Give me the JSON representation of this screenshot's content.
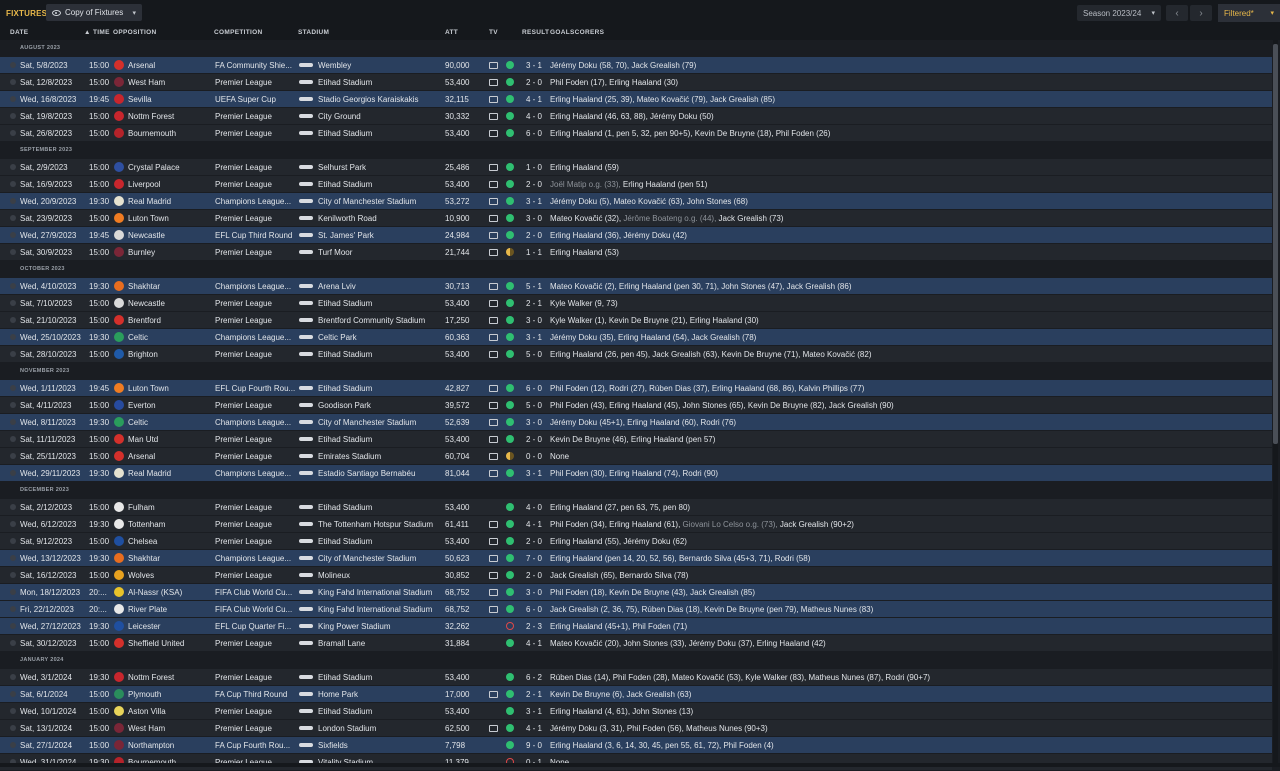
{
  "toolbar": {
    "title": "FIXTURES",
    "view_label": "Copy of Fixtures",
    "season_label": "Season 2023/24",
    "filter_label": "Filtered*"
  },
  "columns": {
    "date": "DATE",
    "time": "TIME",
    "opposition": "OPPOSITION",
    "competition": "COMPETITION",
    "stadium": "STADIUM",
    "att": "ATT",
    "tv": "TV",
    "result": "RESULT",
    "goalscorers": "GOALSCORERS"
  },
  "colors": {
    "accent": "#e8b84a",
    "highlight_row": "#2a3f5e",
    "win": "#2fbf71",
    "draw": "#e8b84a",
    "loss": "#e04848"
  },
  "months": [
    {
      "label": "AUGUST 2023",
      "rows": [
        {
          "date": "Sat, 5/8/2023",
          "time": "15:00",
          "opp": "Arsenal",
          "crest": "#d4302b",
          "comp": "FA Community Shie...",
          "stadium": "Wembley",
          "att": "90,000",
          "tv": true,
          "result": "w",
          "score": "3 - 1",
          "goals": "Jérémy Doku (58, 70), Jack Grealish (79)",
          "hl": true
        },
        {
          "date": "Sat, 12/8/2023",
          "time": "15:00",
          "opp": "West Ham",
          "crest": "#7a2637",
          "comp": "Premier League",
          "stadium": "Etihad Stadium",
          "att": "53,400",
          "tv": true,
          "result": "w",
          "score": "2 - 0",
          "goals": "Phil Foden (17), Erling Haaland (30)",
          "hl": false
        },
        {
          "date": "Wed, 16/8/2023",
          "time": "19:45",
          "opp": "Sevilla",
          "crest": "#c8262d",
          "comp": "UEFA Super Cup",
          "stadium": "Stadio Georgios Karaiskakis",
          "att": "32,115",
          "tv": true,
          "result": "w",
          "score": "4 - 1",
          "goals": "Erling Haaland (25, 39), Mateo Kovačić (79), Jack Grealish (85)",
          "hl": true
        },
        {
          "date": "Sat, 19/8/2023",
          "time": "15:00",
          "opp": "Nottm Forest",
          "crest": "#c8262d",
          "comp": "Premier League",
          "stadium": "City Ground",
          "att": "30,332",
          "tv": true,
          "result": "w",
          "score": "4 - 0",
          "goals": "Erling Haaland (46, 63, 88), Jérémy Doku (50)",
          "hl": false
        },
        {
          "date": "Sat, 26/8/2023",
          "time": "15:00",
          "opp": "Bournemouth",
          "crest": "#b5232a",
          "comp": "Premier League",
          "stadium": "Etihad Stadium",
          "att": "53,400",
          "tv": true,
          "result": "w",
          "score": "6 - 0",
          "goals": "Erling Haaland (1, pen 5, 32, pen 90+5), Kevin De Bruyne (18), Phil Foden (26)",
          "hl": false
        }
      ]
    },
    {
      "label": "SEPTEMBER 2023",
      "rows": [
        {
          "date": "Sat, 2/9/2023",
          "time": "15:00",
          "opp": "Crystal Palace",
          "crest": "#2e4fa0",
          "comp": "Premier League",
          "stadium": "Selhurst Park",
          "att": "25,486",
          "tv": true,
          "result": "w",
          "score": "1 - 0",
          "goals": "Erling Haaland (59)",
          "hl": false
        },
        {
          "date": "Sat, 16/9/2023",
          "time": "15:00",
          "opp": "Liverpool",
          "crest": "#c8262d",
          "comp": "Premier League",
          "stadium": "Etihad Stadium",
          "att": "53,400",
          "tv": true,
          "result": "w",
          "score": "2 - 0",
          "goals_muted": "Joël Matip o.g. (33), ",
          "goals": "Erling Haaland (pen 51)",
          "hl": false
        },
        {
          "date": "Wed, 20/9/2023",
          "time": "19:30",
          "opp": "Real Madrid",
          "crest": "#e5e2d0",
          "comp": "Champions League...",
          "stadium": "City of Manchester Stadium",
          "att": "53,272",
          "tv": true,
          "result": "w",
          "score": "3 - 1",
          "goals": "Jérémy Doku (5), Mateo Kovačić (63), John Stones (68)",
          "hl": true
        },
        {
          "date": "Sat, 23/9/2023",
          "time": "15:00",
          "opp": "Luton Town",
          "crest": "#f07c22",
          "comp": "Premier League",
          "stadium": "Kenilworth Road",
          "att": "10,900",
          "tv": true,
          "result": "w",
          "score": "3 - 0",
          "goals": "Mateo Kovačić (32), ",
          "goals_muted2": "Jérôme Boateng o.g. (44), ",
          "goals2": "Jack Grealish (73)",
          "hl": false
        },
        {
          "date": "Wed, 27/9/2023",
          "time": "19:45",
          "opp": "Newcastle",
          "crest": "#d9d9d9",
          "comp": "EFL Cup Third Round",
          "stadium": "St. James' Park",
          "att": "24,984",
          "tv": true,
          "result": "w",
          "score": "2 - 0",
          "goals": "Erling Haaland (36), Jérémy Doku (42)",
          "hl": true
        },
        {
          "date": "Sat, 30/9/2023",
          "time": "15:00",
          "opp": "Burnley",
          "crest": "#7a2637",
          "comp": "Premier League",
          "stadium": "Turf Moor",
          "att": "21,744",
          "tv": true,
          "result": "d",
          "score": "1 - 1",
          "goals": "Erling Haaland (53)",
          "hl": false
        }
      ]
    },
    {
      "label": "OCTOBER 2023",
      "rows": [
        {
          "date": "Wed, 4/10/2023",
          "time": "19:30",
          "opp": "Shakhtar",
          "crest": "#e86d1f",
          "comp": "Champions League...",
          "stadium": "Arena Lviv",
          "att": "30,713",
          "tv": true,
          "result": "w",
          "score": "5 - 1",
          "goals": "Mateo Kovačić (2), Erling Haaland (pen 30, 71), John Stones (47), Jack Grealish (86)",
          "hl": true
        },
        {
          "date": "Sat, 7/10/2023",
          "time": "15:00",
          "opp": "Newcastle",
          "crest": "#d9d9d9",
          "comp": "Premier League",
          "stadium": "Etihad Stadium",
          "att": "53,400",
          "tv": true,
          "result": "w",
          "score": "2 - 1",
          "goals": "Kyle Walker (9, 73)",
          "hl": false
        },
        {
          "date": "Sat, 21/10/2023",
          "time": "15:00",
          "opp": "Brentford",
          "crest": "#d4302b",
          "comp": "Premier League",
          "stadium": "Brentford Community Stadium",
          "att": "17,250",
          "tv": true,
          "result": "w",
          "score": "3 - 0",
          "goals": "Kyle Walker (1), Kevin De Bruyne (21), Erling Haaland (30)",
          "hl": false
        },
        {
          "date": "Wed, 25/10/2023",
          "time": "19:30",
          "opp": "Celtic",
          "crest": "#2a9d5c",
          "comp": "Champions League...",
          "stadium": "Celtic Park",
          "att": "60,363",
          "tv": true,
          "result": "w",
          "score": "3 - 1",
          "goals": "Jérémy Doku (35), Erling Haaland (54), Jack Grealish (78)",
          "hl": true
        },
        {
          "date": "Sat, 28/10/2023",
          "time": "15:00",
          "opp": "Brighton",
          "crest": "#1f5aa8",
          "comp": "Premier League",
          "stadium": "Etihad Stadium",
          "att": "53,400",
          "tv": true,
          "result": "w",
          "score": "5 - 0",
          "goals": "Erling Haaland (26, pen 45), Jack Grealish (63), Kevin De Bruyne (71), Mateo Kovačić (82)",
          "hl": false
        }
      ]
    },
    {
      "label": "NOVEMBER 2023",
      "rows": [
        {
          "date": "Wed, 1/11/2023",
          "time": "19:45",
          "opp": "Luton Town",
          "crest": "#f07c22",
          "comp": "EFL Cup Fourth Rou...",
          "stadium": "Etihad Stadium",
          "att": "42,827",
          "tv": true,
          "result": "w",
          "score": "6 - 0",
          "goals": "Phil Foden (12), Rodri (27), Rúben Dias (37), Erling Haaland (68, 86), Kalvin Phillips (77)",
          "hl": true
        },
        {
          "date": "Sat, 4/11/2023",
          "time": "15:00",
          "opp": "Everton",
          "crest": "#274b9f",
          "comp": "Premier League",
          "stadium": "Goodison Park",
          "att": "39,572",
          "tv": true,
          "result": "w",
          "score": "5 - 0",
          "goals": "Phil Foden (43), Erling Haaland (45), John Stones (65), Kevin De Bruyne (82), Jack Grealish (90)",
          "hl": false
        },
        {
          "date": "Wed, 8/11/2023",
          "time": "19:30",
          "opp": "Celtic",
          "crest": "#2a9d5c",
          "comp": "Champions League...",
          "stadium": "City of Manchester Stadium",
          "att": "52,639",
          "tv": true,
          "result": "w",
          "score": "3 - 0",
          "goals": "Jérémy Doku (45+1), Erling Haaland (60), Rodri (76)",
          "hl": true
        },
        {
          "date": "Sat, 11/11/2023",
          "time": "15:00",
          "opp": "Man Utd",
          "crest": "#d4302b",
          "comp": "Premier League",
          "stadium": "Etihad Stadium",
          "att": "53,400",
          "tv": true,
          "result": "w",
          "score": "2 - 0",
          "goals": "Kevin De Bruyne (46), Erling Haaland (pen 57)",
          "hl": false
        },
        {
          "date": "Sat, 25/11/2023",
          "time": "15:00",
          "opp": "Arsenal",
          "crest": "#d4302b",
          "comp": "Premier League",
          "stadium": "Emirates Stadium",
          "att": "60,704",
          "tv": true,
          "result": "d",
          "score": "0 - 0",
          "goals": "None",
          "hl": false
        },
        {
          "date": "Wed, 29/11/2023",
          "time": "19:30",
          "opp": "Real Madrid",
          "crest": "#e5e2d0",
          "comp": "Champions League...",
          "stadium": "Estadio Santiago Bernabéu",
          "att": "81,044",
          "tv": true,
          "result": "w",
          "score": "3 - 1",
          "goals": "Phil Foden (30), Erling Haaland (74), Rodri (90)",
          "hl": true
        }
      ]
    },
    {
      "label": "DECEMBER 2023",
      "rows": [
        {
          "date": "Sat, 2/12/2023",
          "time": "15:00",
          "opp": "Fulham",
          "crest": "#e8e8e8",
          "comp": "Premier League",
          "stadium": "Etihad Stadium",
          "att": "53,400",
          "tv": false,
          "result": "w",
          "score": "4 - 0",
          "goals": "Erling Haaland (27, pen 63, 75, pen 80)",
          "hl": false
        },
        {
          "date": "Wed, 6/12/2023",
          "time": "19:30",
          "opp": "Tottenham",
          "crest": "#e8e8e8",
          "comp": "Premier League",
          "stadium": "The Tottenham Hotspur Stadium",
          "att": "61,411",
          "tv": true,
          "result": "w",
          "score": "4 - 1",
          "goals": "Phil Foden (34), Erling Haaland (61), ",
          "goals_muted2": "Giovani Lo Celso o.g. (73), ",
          "goals2": "Jack Grealish (90+2)",
          "hl": false
        },
        {
          "date": "Sat, 9/12/2023",
          "time": "15:00",
          "opp": "Chelsea",
          "crest": "#1f4fa0",
          "comp": "Premier League",
          "stadium": "Etihad Stadium",
          "att": "53,400",
          "tv": true,
          "result": "w",
          "score": "2 - 0",
          "goals": "Erling Haaland (55), Jérémy Doku (62)",
          "hl": false
        },
        {
          "date": "Wed, 13/12/2023",
          "time": "19:30",
          "opp": "Shakhtar",
          "crest": "#e86d1f",
          "comp": "Champions League...",
          "stadium": "City of Manchester Stadium",
          "att": "50,623",
          "tv": true,
          "result": "w",
          "score": "7 - 0",
          "goals": "Erling Haaland (pen 14, 20, 52, 56), Bernardo Silva (45+3, 71), Rodri (58)",
          "hl": true
        },
        {
          "date": "Sat, 16/12/2023",
          "time": "15:00",
          "opp": "Wolves",
          "crest": "#e8a21f",
          "comp": "Premier League",
          "stadium": "Molineux",
          "att": "30,852",
          "tv": true,
          "result": "w",
          "score": "2 - 0",
          "goals": "Jack Grealish (65), Bernardo Silva (78)",
          "hl": false
        },
        {
          "date": "Mon, 18/12/2023",
          "time": "20:...",
          "opp": "Al-Nassr (KSA)",
          "crest": "#e8c32a",
          "comp": "FIFA Club World Cu...",
          "stadium": "King Fahd International Stadium",
          "att": "68,752",
          "tv": true,
          "result": "w",
          "score": "3 - 0",
          "goals": "Phil Foden (18), Kevin De Bruyne (43), Jack Grealish (85)",
          "hl": true
        },
        {
          "date": "Fri, 22/12/2023",
          "time": "20:...",
          "opp": "River Plate",
          "crest": "#e8e8e8",
          "comp": "FIFA Club World Cu...",
          "stadium": "King Fahd International Stadium",
          "att": "68,752",
          "tv": true,
          "result": "w",
          "score": "6 - 0",
          "goals": "Jack Grealish (2, 36, 75), Rúben Dias (18), Kevin De Bruyne (pen 79), Matheus Nunes (83)",
          "hl": true
        },
        {
          "date": "Wed, 27/12/2023",
          "time": "19:30",
          "opp": "Leicester",
          "crest": "#1f4fa0",
          "comp": "EFL Cup Quarter Fi...",
          "stadium": "King Power Stadium",
          "att": "32,262",
          "tv": false,
          "result": "l",
          "score": "2 - 3",
          "goals": "Erling Haaland (45+1), Phil Foden (71)",
          "hl": true
        },
        {
          "date": "Sat, 30/12/2023",
          "time": "15:00",
          "opp": "Sheffield United",
          "crest": "#d4302b",
          "comp": "Premier League",
          "stadium": "Bramall Lane",
          "att": "31,884",
          "tv": false,
          "result": "w",
          "score": "4 - 1",
          "goals": "Mateo Kovačić (20), John Stones (33), Jérémy Doku (37), Erling Haaland (42)",
          "hl": false
        }
      ]
    },
    {
      "label": "JANUARY 2024",
      "rows": [
        {
          "date": "Wed, 3/1/2024",
          "time": "19:30",
          "opp": "Nottm Forest",
          "crest": "#c8262d",
          "comp": "Premier League",
          "stadium": "Etihad Stadium",
          "att": "53,400",
          "tv": false,
          "result": "w",
          "score": "6 - 2",
          "goals": "Rúben Dias (14), Phil Foden (28), Mateo Kovačić (53), Kyle Walker (83), Matheus Nunes (87), Rodri (90+7)",
          "hl": false
        },
        {
          "date": "Sat, 6/1/2024",
          "time": "15:00",
          "opp": "Plymouth",
          "crest": "#2a8d5c",
          "comp": "FA Cup Third Round",
          "stadium": "Home Park",
          "att": "17,000",
          "tv": true,
          "result": "w",
          "score": "2 - 1",
          "goals": "Kevin De Bruyne (6), Jack Grealish (63)",
          "hl": true
        },
        {
          "date": "Wed, 10/1/2024",
          "time": "15:00",
          "opp": "Aston Villa",
          "crest": "#e8d45a",
          "comp": "Premier League",
          "stadium": "Etihad Stadium",
          "att": "53,400",
          "tv": false,
          "result": "w",
          "score": "3 - 1",
          "goals": "Erling Haaland (4, 61), John Stones (13)",
          "hl": false
        },
        {
          "date": "Sat, 13/1/2024",
          "time": "15:00",
          "opp": "West Ham",
          "crest": "#7a2637",
          "comp": "Premier League",
          "stadium": "London Stadium",
          "att": "62,500",
          "tv": true,
          "result": "w",
          "score": "4 - 1",
          "goals": "Jérémy Doku (3, 31), Phil Foden (56), Matheus Nunes (90+3)",
          "hl": false
        },
        {
          "date": "Sat, 27/1/2024",
          "time": "15:00",
          "opp": "Northampton",
          "crest": "#7a2637",
          "comp": "FA Cup Fourth Rou...",
          "stadium": "Sixfields",
          "att": "7,798",
          "tv": false,
          "result": "w",
          "score": "9 - 0",
          "goals": "Erling Haaland (3, 6, 14, 30, 45, pen 55, 61, 72), Phil Foden (4)",
          "hl": true
        },
        {
          "date": "Wed, 31/1/2024",
          "time": "19:30",
          "opp": "Bournemouth",
          "crest": "#b5232a",
          "comp": "Premier League",
          "stadium": "Vitality Stadium",
          "att": "11,379",
          "tv": false,
          "result": "l",
          "score": "0 - 1",
          "goals": "None",
          "hl": false
        }
      ]
    }
  ]
}
